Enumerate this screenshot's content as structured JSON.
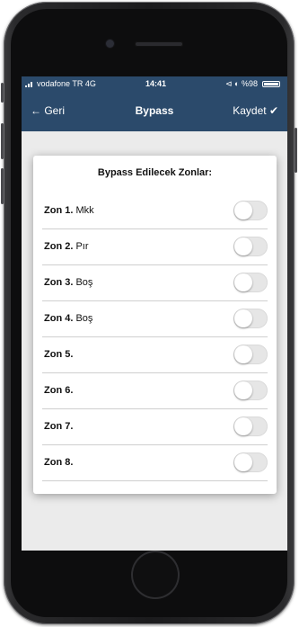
{
  "status_bar": {
    "carrier": "vodafone TR  4G",
    "time": "14:41",
    "icons_text": "⊲ ◐ %98"
  },
  "nav": {
    "back_icon": "←",
    "back_label": "Geri",
    "title": "Bypass",
    "save_label": "Kaydet",
    "save_icon": "✔"
  },
  "card": {
    "title": "Bypass Edilecek Zonlar:"
  },
  "zones": [
    {
      "num": "Zon 1.",
      "name": " Mkk",
      "enabled": false
    },
    {
      "num": "Zon 2.",
      "name": " Pır",
      "enabled": false
    },
    {
      "num": "Zon 3.",
      "name": " Boş",
      "enabled": false
    },
    {
      "num": "Zon 4.",
      "name": " Boş",
      "enabled": false
    },
    {
      "num": "Zon 5.",
      "name": "",
      "enabled": false
    },
    {
      "num": "Zon 6.",
      "name": "",
      "enabled": false
    },
    {
      "num": "Zon 7.",
      "name": "",
      "enabled": false
    },
    {
      "num": "Zon 8.",
      "name": "",
      "enabled": false
    }
  ],
  "colors": {
    "nav_background": "#2b4a6b",
    "toggle_off": "#e6e6e6",
    "screen_background": "#ebebeb"
  }
}
